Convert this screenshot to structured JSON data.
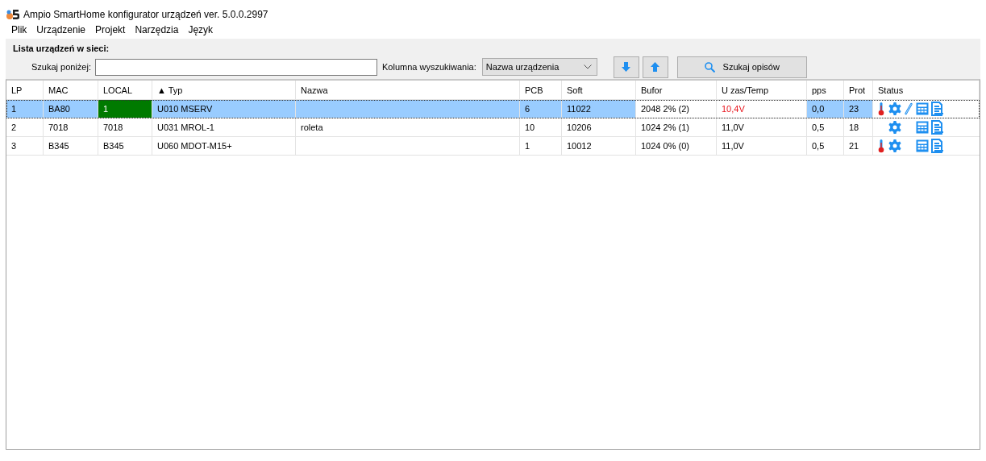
{
  "window": {
    "title": "Ampio SmartHome konfigurator urządzeń ver. 5.0.0.2997"
  },
  "menu": [
    "Plik",
    "Urządzenie",
    "Projekt",
    "Narzędzia",
    "Język"
  ],
  "panel": {
    "title": "Lista urządzeń w sieci:",
    "search_label": "Szukaj poniżej:",
    "column_label": "Kolumna wyszukiwania:",
    "column_value": "Nazwa urządzenia",
    "search_button": "Szukaj opisów"
  },
  "table": {
    "columns": [
      "LP",
      "MAC",
      "LOCAL",
      "▲ Typ",
      "Nazwa",
      "PCB",
      "Soft",
      "Bufor",
      "U zas/Temp",
      "pps",
      "Prot",
      "Status"
    ],
    "rows": [
      {
        "selected": true,
        "cells": [
          {
            "text": "1"
          },
          {
            "text": "BA80"
          },
          {
            "text": "1",
            "kind": "local"
          },
          {
            "text": "U010 MSERV"
          },
          {
            "text": ""
          },
          {
            "text": "6"
          },
          {
            "text": "11022"
          },
          {
            "text": "2048 2% (2)",
            "kind": "plain"
          },
          {
            "text": "10,4V",
            "kind": "warn"
          },
          {
            "text": "0,0"
          },
          {
            "text": "23"
          }
        ],
        "status": {
          "thermometer": true,
          "gear": true,
          "link": true,
          "calculator": true,
          "list": true
        }
      },
      {
        "selected": false,
        "cells": [
          {
            "text": "2"
          },
          {
            "text": "7018"
          },
          {
            "text": "7018"
          },
          {
            "text": "U031 MROL-1"
          },
          {
            "text": "roleta"
          },
          {
            "text": "10"
          },
          {
            "text": "10206"
          },
          {
            "text": "1024 2% (1)"
          },
          {
            "text": "11,0V"
          },
          {
            "text": "0,5"
          },
          {
            "text": "18"
          }
        ],
        "status": {
          "thermometer": false,
          "gear": true,
          "link": false,
          "calculator": true,
          "list": true
        }
      },
      {
        "selected": false,
        "cells": [
          {
            "text": "3"
          },
          {
            "text": "B345"
          },
          {
            "text": "B345"
          },
          {
            "text": "U060 MDOT-M15+"
          },
          {
            "text": ""
          },
          {
            "text": "1"
          },
          {
            "text": "10012"
          },
          {
            "text": "1024 0% (0)"
          },
          {
            "text": "11,0V"
          },
          {
            "text": "0,5"
          },
          {
            "text": "21"
          }
        ],
        "status": {
          "thermometer": true,
          "gear": true,
          "link": false,
          "calculator": true,
          "list": true
        }
      }
    ]
  }
}
